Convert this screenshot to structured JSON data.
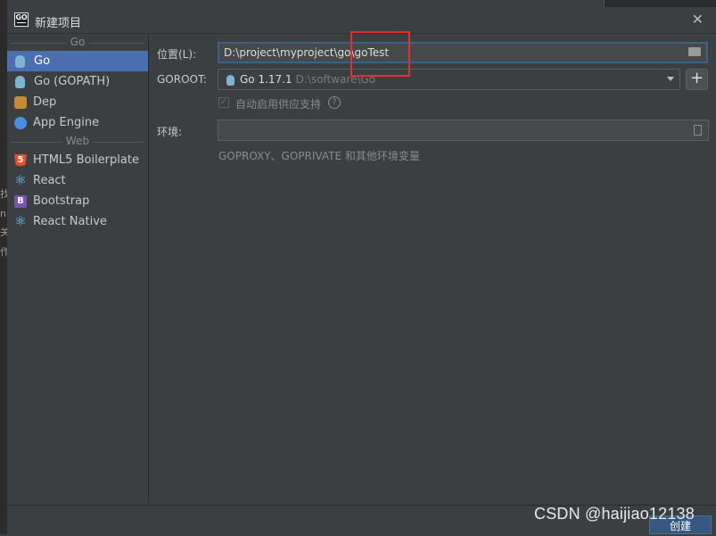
{
  "window": {
    "title": "新建项目",
    "icon_label": "GO"
  },
  "sidebar": {
    "groups": [
      {
        "name": "Go",
        "items": [
          {
            "label": "Go",
            "icon": "gopher-icon",
            "selected": true
          },
          {
            "label": "Go (GOPATH)",
            "icon": "gopher-icon"
          },
          {
            "label": "Dep",
            "icon": "dep-icon"
          },
          {
            "label": "App Engine",
            "icon": "app-engine-icon"
          }
        ]
      },
      {
        "name": "Web",
        "items": [
          {
            "label": "HTML5 Boilerplate",
            "icon": "html5-icon",
            "icon_text": "5"
          },
          {
            "label": "React",
            "icon": "react-icon",
            "icon_text": "⚛"
          },
          {
            "label": "Bootstrap",
            "icon": "bootstrap-icon",
            "icon_text": "B"
          },
          {
            "label": "React Native",
            "icon": "react-icon",
            "icon_text": "⚛"
          }
        ]
      }
    ]
  },
  "form": {
    "location_label": "位置(L):",
    "location_value": "D:\\project\\myproject\\go\\goTest",
    "goroot_label": "GOROOT:",
    "goroot_version": "Go 1.17.1",
    "goroot_path": "D:\\software\\Go",
    "vendor_label": "自动启用供应支持",
    "vendor_checked": true,
    "env_label": "环境:",
    "env_value": "",
    "env_hint": "GOPROXY、GOPRIVATE 和其他环境变量"
  },
  "buttons": {
    "create": "创建",
    "add": "+"
  },
  "watermark": "CSDN @haijiao12138",
  "edge_glyphs": [
    "找",
    "n",
    "关",
    "作"
  ],
  "colors": {
    "selection": "#4b6eaf",
    "annotation": "#e0302f",
    "create_button": "#365880"
  }
}
